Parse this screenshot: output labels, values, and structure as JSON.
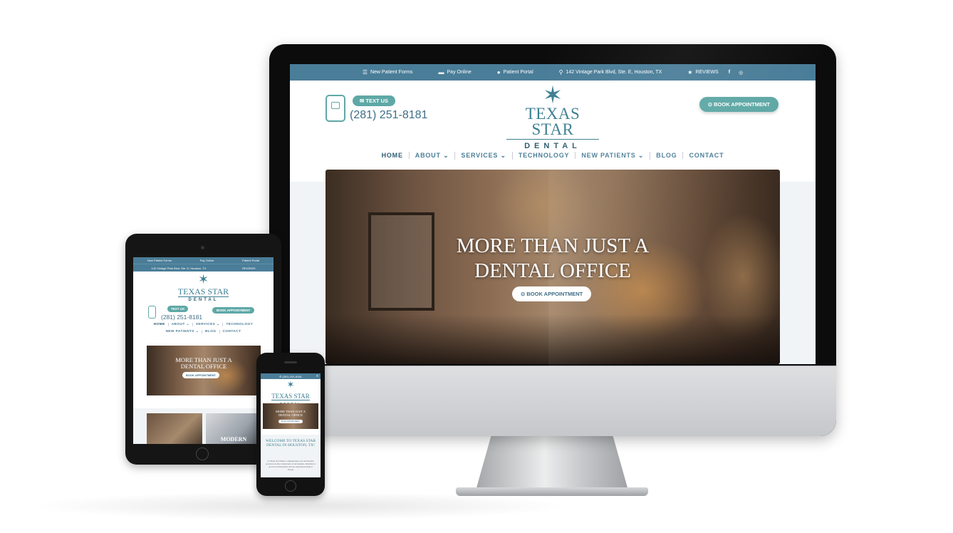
{
  "desktop": {
    "topbar": {
      "new_patient_forms": "New Patient Forms",
      "pay_online": "Pay Online",
      "patient_portal": "Patient Portal",
      "address": "142 Vintage Park Blvd, Ste. E, Houston, TX",
      "reviews": "REVIEWS",
      "facebook": "f",
      "instagram": "◎"
    },
    "header": {
      "text_us": "TEXT US",
      "phone": "(281) 251-8181",
      "logo_line1": "TEXAS STAR",
      "logo_line2": "DENTAL",
      "book_appointment": "BOOK APPOINTMENT"
    },
    "nav": [
      "HOME",
      "ABOUT ⌄",
      "SERVICES ⌄",
      "TECHNOLOGY",
      "NEW PATIENTS ⌄",
      "BLOG",
      "CONTACT"
    ],
    "hero": {
      "title_line1": "MORE THAN JUST A",
      "title_line2": "DENTAL OFFICE",
      "button": "BOOK APPOINTMENT"
    }
  },
  "tablet": {
    "topbar": {
      "new_patient_forms": "New Patient Forms",
      "pay_online": "Pay Online",
      "patient_portal": "Patient Portal",
      "address": "142 Vintage Park Blvd, Ste. E, Houston, TX",
      "reviews": "REVIEWS"
    },
    "logo_line1": "TEXAS STAR",
    "logo_line2": "DENTAL",
    "text_us": "TEXT US",
    "phone": "(281) 251-8181",
    "book_appointment": "BOOK APPOINTMENT",
    "nav_row1": [
      "HOME",
      "ABOUT ⌄",
      "SERVICES ⌄",
      "TECHNOLOGY"
    ],
    "nav_row2": [
      "NEW PATIENTS ⌄",
      "BLOG",
      "CONTACT"
    ],
    "hero_line1": "MORE THAN JUST A",
    "hero_line2": "DENTAL OFFICE",
    "hero_button": "BOOK APPOINTMENT",
    "card2_label": "MODERN"
  },
  "phone": {
    "topbar_phone": "(281) 251-8181",
    "menu": "≡",
    "logo_line1": "TEXAS STAR",
    "logo_line2": "DENTAL",
    "hero_line1": "MORE THAN JUST A",
    "hero_line2": "DENTAL OFFICE",
    "hero_button": "BOOK APPOINTMENT",
    "welcome": "WELCOME TO TEXAS STAR DENTAL IN HOUSTON, TX!",
    "paragraph": "At Texas Star Dental, compassionate care and modern practices are the cornerstones of our business. Dentistry is an ever-evolving field, and our experienced team is always"
  },
  "colors": {
    "brand_teal": "#5ea8a6",
    "brand_blue": "#4a7d98",
    "logo_blue": "#3d7f91"
  },
  "icons": {
    "forms": "list-icon",
    "pay": "credit-card-icon",
    "portal": "user-icon",
    "address": "map-pin-icon",
    "reviews": "star-icon"
  }
}
